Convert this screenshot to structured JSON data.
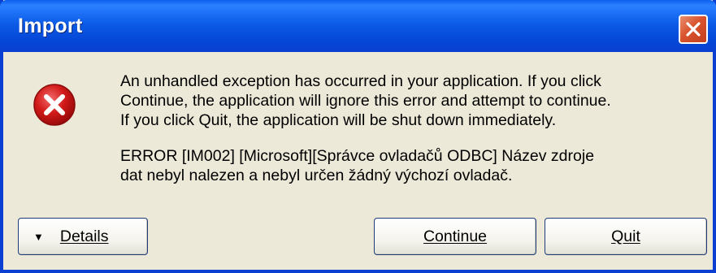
{
  "window": {
    "title": "Import",
    "close_icon": "close-x-icon"
  },
  "message": {
    "icon": "error-icon",
    "line1": "An unhandled exception has occurred in your application. If you click",
    "line2": "Continue, the application will ignore this error and attempt to continue.",
    "line3": "If you click Quit, the application will be shut down immediately.",
    "error_line1": "ERROR [IM002] [Microsoft][Správce ovladačů ODBC] Název zdroje",
    "error_line2": "dat nebyl nalezen a nebyl určen žádný výchozí ovladač."
  },
  "buttons": {
    "details": "Details",
    "details_icon": "triangle-down-icon",
    "continue": "Continue",
    "quit": "Quit"
  },
  "colors": {
    "titlebar": "#0a5fef",
    "close_button": "#d9532e",
    "error_icon": "#c8102e",
    "background": "#ece9d8"
  }
}
